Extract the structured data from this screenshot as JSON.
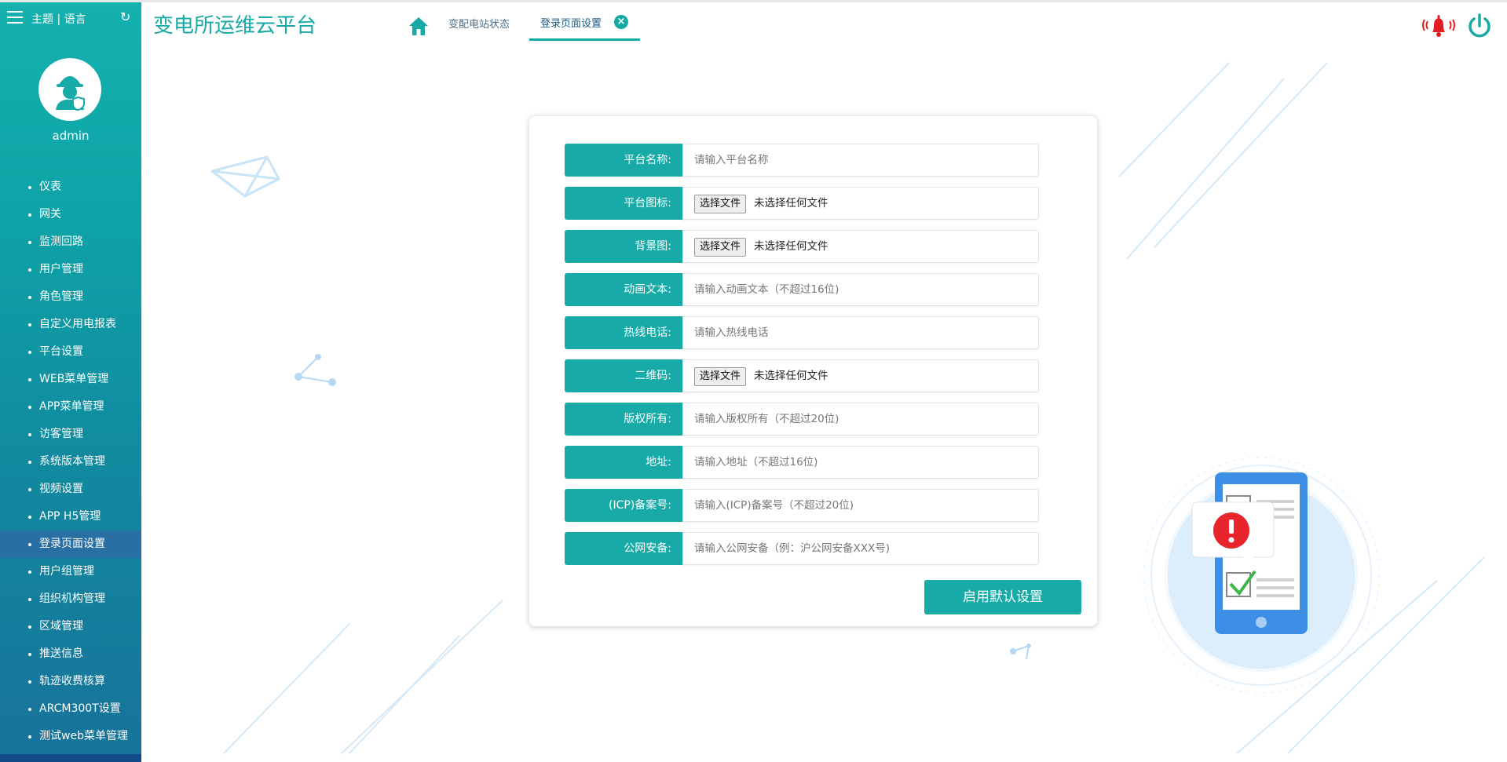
{
  "sidebar": {
    "theme_lang": "主题 | 语言",
    "username": "admin",
    "items": [
      {
        "label": "仪表"
      },
      {
        "label": "网关"
      },
      {
        "label": "监测回路"
      },
      {
        "label": "用户管理"
      },
      {
        "label": "角色管理"
      },
      {
        "label": "自定义用电报表"
      },
      {
        "label": "平台设置"
      },
      {
        "label": "WEB菜单管理"
      },
      {
        "label": "APP菜单管理"
      },
      {
        "label": "访客管理"
      },
      {
        "label": "系统版本管理"
      },
      {
        "label": "视频设置"
      },
      {
        "label": "APP H5管理"
      },
      {
        "label": "登录页面设置",
        "active": true
      },
      {
        "label": "用户组管理"
      },
      {
        "label": "组织机构管理"
      },
      {
        "label": "区域管理"
      },
      {
        "label": "推送信息"
      },
      {
        "label": "轨迹收费核算"
      },
      {
        "label": "ARCM300T设置"
      },
      {
        "label": "测试web菜单管理"
      }
    ]
  },
  "header": {
    "title": "变电所运维云平台",
    "tabs": [
      {
        "label": "变配电站状态"
      },
      {
        "label": "登录页面设置",
        "active": true,
        "closable": true
      }
    ]
  },
  "form": {
    "fields": [
      {
        "label": "平台名称:",
        "type": "text",
        "placeholder": "请输入平台名称"
      },
      {
        "label": "平台图标:",
        "type": "file",
        "button": "选择文件",
        "status": "未选择任何文件"
      },
      {
        "label": "背景图:",
        "type": "file",
        "button": "选择文件",
        "status": "未选择任何文件"
      },
      {
        "label": "动画文本:",
        "type": "text",
        "placeholder": "请输入动画文本（不超过16位)"
      },
      {
        "label": "热线电话:",
        "type": "text",
        "placeholder": "请输入热线电话"
      },
      {
        "label": "二维码:",
        "type": "file",
        "button": "选择文件",
        "status": "未选择任何文件"
      },
      {
        "label": "版权所有:",
        "type": "text",
        "placeholder": "请输入版权所有（不超过20位)"
      },
      {
        "label": "地址:",
        "type": "text",
        "placeholder": "请输入地址（不超过16位)"
      },
      {
        "label": "(ICP)备案号:",
        "type": "text",
        "placeholder": "请输入(ICP)备案号（不超过20位)"
      },
      {
        "label": "公网安备:",
        "type": "text",
        "placeholder": "请输入公网安备（例：沪公网安备XXX号)"
      }
    ],
    "default_button": "启用默认设置"
  },
  "colors": {
    "accent": "#17aaa7",
    "sidebar_active": "#2a6fa3",
    "alert": "#e02020"
  },
  "icons": [
    "menu-icon",
    "refresh-icon",
    "avatar-worker-icon",
    "home-icon",
    "close-icon",
    "bell-icon",
    "power-icon"
  ]
}
